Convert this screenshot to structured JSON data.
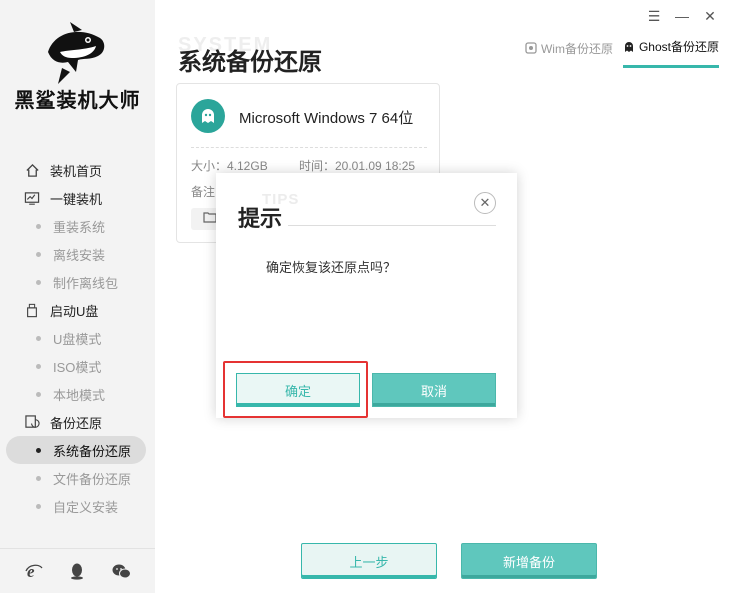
{
  "app": {
    "brand": "黑鲨装机大师"
  },
  "window_controls": {
    "menu": "☰",
    "minimize": "—",
    "close": "✕"
  },
  "sidebar": {
    "items": [
      {
        "label": "装机首页",
        "type": "group",
        "icon": "home-icon"
      },
      {
        "label": "一键装机",
        "type": "group",
        "icon": "monitor-icon"
      },
      {
        "label": "重装系统",
        "type": "sub"
      },
      {
        "label": "离线安装",
        "type": "sub"
      },
      {
        "label": "制作离线包",
        "type": "sub"
      },
      {
        "label": "启动U盘",
        "type": "group",
        "icon": "usb-icon"
      },
      {
        "label": "U盘模式",
        "type": "sub"
      },
      {
        "label": "ISO模式",
        "type": "sub"
      },
      {
        "label": "本地模式",
        "type": "sub"
      },
      {
        "label": "备份还原",
        "type": "group",
        "icon": "backup-icon"
      },
      {
        "label": "系统备份还原",
        "type": "sub",
        "active": true
      },
      {
        "label": "文件备份还原",
        "type": "sub"
      },
      {
        "label": "自定义安装",
        "type": "sub"
      }
    ],
    "footer_icons": [
      "ie-icon",
      "qq-icon",
      "wechat-icon"
    ]
  },
  "header": {
    "watermark": "SYSTEM",
    "title": "系统备份还原",
    "tabs": [
      {
        "label": "Wim备份还原",
        "active": false,
        "icon": "wim-icon"
      },
      {
        "label": "Ghost备份还原",
        "active": true,
        "icon": "ghost-icon"
      }
    ]
  },
  "card": {
    "os_name": "Microsoft Windows 7 64位",
    "size": "大小：4.12GB",
    "time": "时间：20.01.09 18:25",
    "note": "备注"
  },
  "buttons": {
    "prev": "上一步",
    "new_backup": "新增备份"
  },
  "dialog": {
    "watermark": "TIPS",
    "title": "提示",
    "message": "确定恢复该还原点吗？",
    "ok": "确定",
    "cancel": "取消",
    "close": "✕"
  },
  "colors": {
    "accent": "#37b7ab",
    "accent_fill": "#5fc7bd",
    "highlight": "#e53333"
  }
}
